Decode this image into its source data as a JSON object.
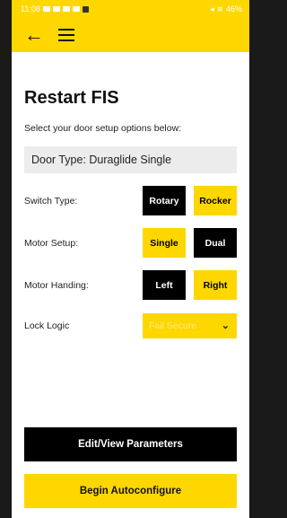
{
  "status_bar": {
    "time": "11:08",
    "battery": "46%"
  },
  "header": {
    "back_icon": "arrow-left-icon",
    "menu_icon": "hamburger-menu-icon"
  },
  "page": {
    "title": "Restart FIS",
    "subtitle": "Select your door setup options below:",
    "door_type": "Door Type: Duraglide Single"
  },
  "options": {
    "switch_type": {
      "label": "Switch Type:",
      "option_a": "Rotary",
      "option_b": "Rocker",
      "selected": "Rotary"
    },
    "motor_setup": {
      "label": "Motor Setup:",
      "option_a": "Single",
      "option_b": "Dual",
      "selected": "Dual"
    },
    "motor_handing": {
      "label": "Motor Handing:",
      "option_a": "Left",
      "option_b": "Right",
      "selected": "Left"
    },
    "lock_logic": {
      "label": "Lock Logic",
      "value": "Fail Secure"
    }
  },
  "actions": {
    "edit_view": "Edit/View Parameters",
    "begin_autoconfigure": "Begin Autoconfigure"
  },
  "colors": {
    "accent": "#ffd700",
    "dark": "#000000"
  }
}
